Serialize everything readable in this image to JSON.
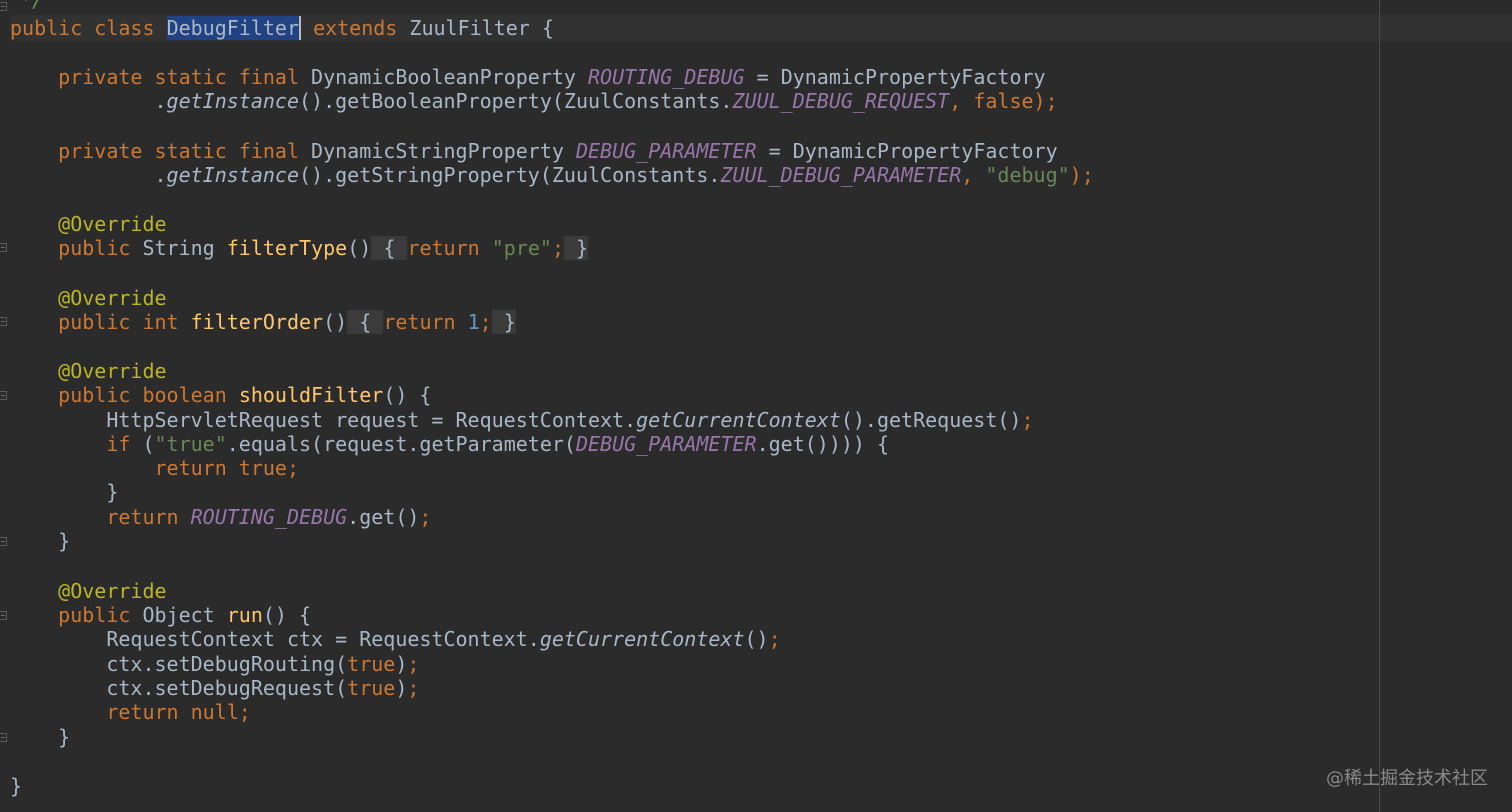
{
  "editor": {
    "language": "java",
    "theme": "Darcula",
    "colors": {
      "background": "#2b2b2b",
      "keyword": "#cc7832",
      "function": "#ffc66d",
      "string": "#6a8759",
      "number": "#6897bb",
      "annotation": "#bbb529",
      "constant": "#9876aa",
      "default_text": "#a9b7c6",
      "selection": "#214283"
    },
    "selected_text": "DebugFilter",
    "watermark": "@稀土掘金技术社区"
  },
  "code": {
    "comment_tail": "*/",
    "class_decl": {
      "public": "public",
      "class": "class",
      "name": "DebugFilter",
      "extends": "extends",
      "super": "ZuulFilter",
      "brace": "{"
    },
    "field1": {
      "modifiers": "private static final",
      "type": "DynamicBooleanProperty",
      "name": "ROUTING_DEBUG",
      "eq": "=",
      "factory": "DynamicPropertyFactory",
      "dot": ".",
      "get_instance": "getInstance",
      "call": "().getBooleanProperty(ZuulConstants.",
      "const_arg": "ZUUL_DEBUG_REQUEST",
      "comma": ",",
      "default": "false",
      "end": ");"
    },
    "field2": {
      "modifiers": "private static final",
      "type": "DynamicStringProperty",
      "name": "DEBUG_PARAMETER",
      "eq": "=",
      "factory": "DynamicPropertyFactory",
      "dot": ".",
      "get_instance": "getInstance",
      "call": "().getStringProperty(ZuulConstants.",
      "const_arg": "ZUUL_DEBUG_PARAMETER",
      "comma": ",",
      "default": "\"debug\"",
      "end": ");"
    },
    "annotation": "@Override",
    "filter_type": {
      "public": "public",
      "type": "String",
      "name": "filterType",
      "parens": "()",
      "open": "{",
      "return": "return",
      "value": "\"pre\"",
      "semi": ";",
      "close": "}"
    },
    "filter_order": {
      "public": "public",
      "type": "int",
      "name": "filterOrder",
      "parens": "()",
      "open": "{",
      "return": "return",
      "value": "1",
      "semi": ";",
      "close": "}"
    },
    "should_filter": {
      "public": "public",
      "type": "boolean",
      "name": "shouldFilter",
      "sig_end": "() {",
      "line1_a": "HttpServletRequest request = RequestContext.",
      "line1_b": "getCurrentContext",
      "line1_c": "().getRequest()",
      "semi": ";",
      "if_kw": "if",
      "if_a": " (",
      "if_str": "\"true\"",
      "if_b": ".equals(request.getParameter(",
      "if_const": "DEBUG_PARAMETER",
      "if_c": ".get()))) {",
      "return": "return",
      "true": "true",
      "close_if": "}",
      "ret_const": "ROUTING_DEBUG",
      "ret_tail": ".get()",
      "close": "}"
    },
    "run": {
      "public": "public",
      "type": "Object",
      "name": "run",
      "sig_end": "() {",
      "line1_a": "RequestContext ctx = RequestContext.",
      "line1_b": "getCurrentContext",
      "line1_c": "()",
      "semi": ";",
      "line2_a": "ctx.setDebugRouting(",
      "line3_a": "ctx.setDebugRequest(",
      "true": "true",
      "paren_close": ")",
      "return": "return",
      "null": "null",
      "close": "}"
    },
    "class_close": "}"
  }
}
